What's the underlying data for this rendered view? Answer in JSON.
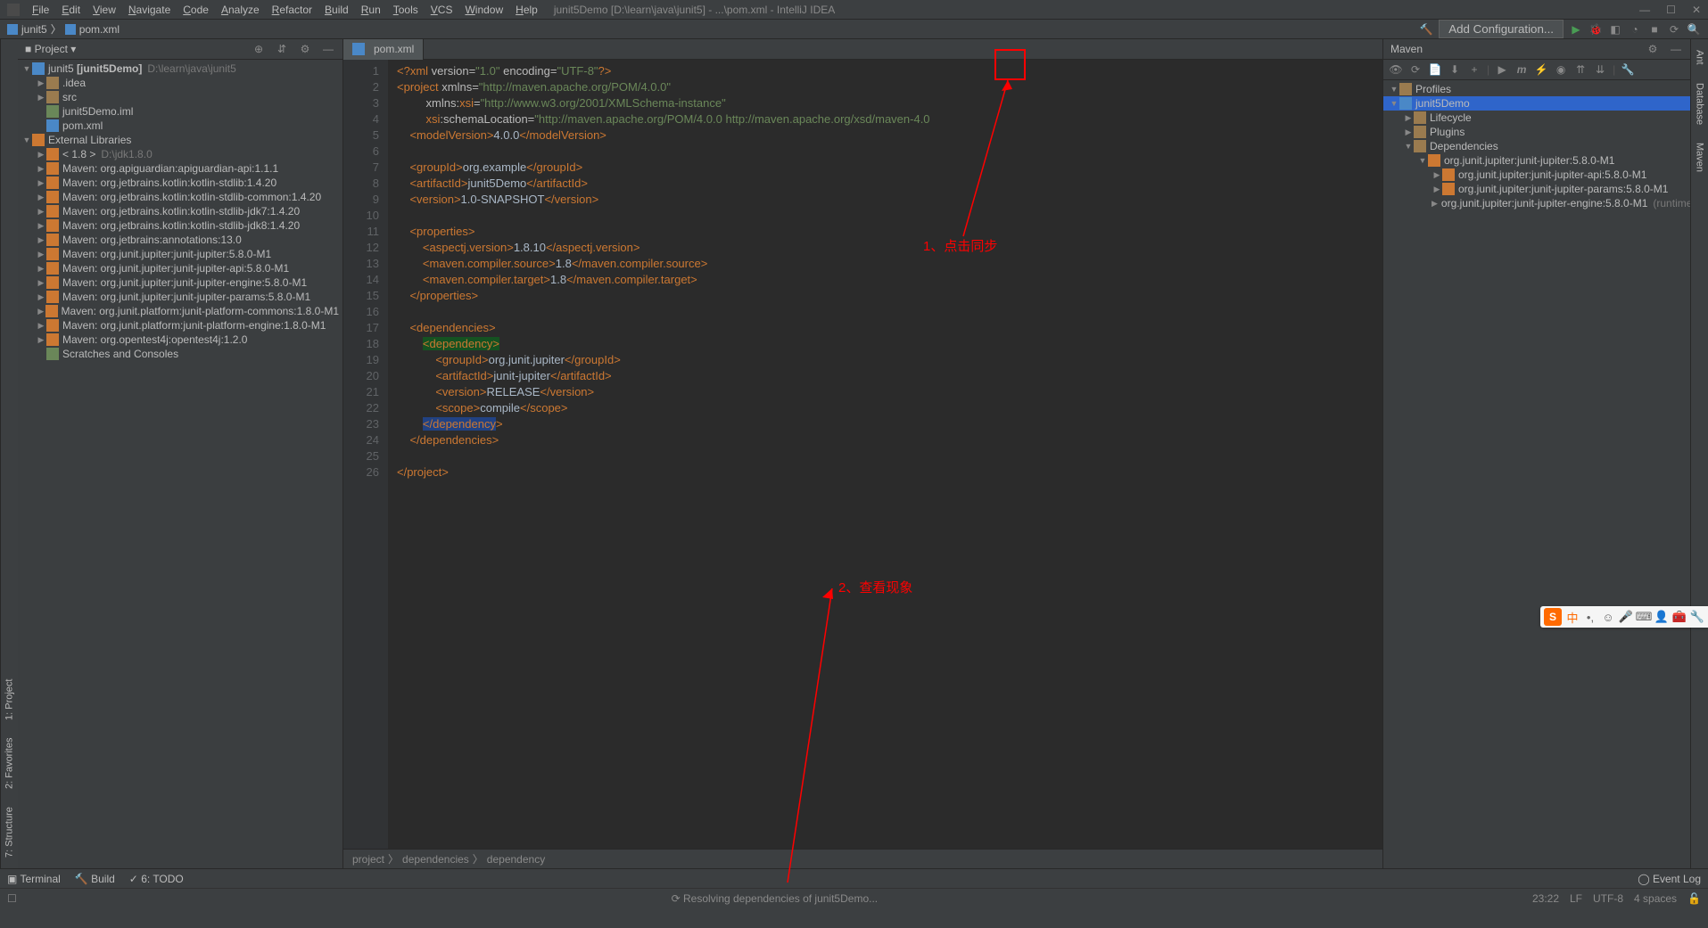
{
  "title_bar": {
    "menus": [
      "File",
      "Edit",
      "View",
      "Navigate",
      "Code",
      "Analyze",
      "Refactor",
      "Build",
      "Run",
      "Tools",
      "VCS",
      "Window",
      "Help"
    ],
    "title": "junit5Demo [D:\\learn\\java\\junit5] - ...\\pom.xml - IntelliJ IDEA"
  },
  "nav": {
    "crumbs": [
      "junit5",
      "pom.xml"
    ],
    "add_config": "Add Configuration..."
  },
  "project": {
    "header": "Project",
    "root": "junit5",
    "root_bold": "[junit5Demo]",
    "root_path": "D:\\learn\\java\\junit5",
    "items": [
      {
        "indent": 1,
        "arrow": "▶",
        "icon": "folder",
        "label": ".idea"
      },
      {
        "indent": 1,
        "arrow": "▶",
        "icon": "folder",
        "label": "src"
      },
      {
        "indent": 1,
        "arrow": "",
        "icon": "file",
        "label": "junit5Demo.iml"
      },
      {
        "indent": 1,
        "arrow": "",
        "icon": "m",
        "label": "pom.xml"
      }
    ],
    "ext_lib": "External Libraries",
    "libs": [
      "< 1.8 >  D:\\jdk1.8.0",
      "Maven: org.apiguardian:apiguardian-api:1.1.1",
      "Maven: org.jetbrains.kotlin:kotlin-stdlib:1.4.20",
      "Maven: org.jetbrains.kotlin:kotlin-stdlib-common:1.4.20",
      "Maven: org.jetbrains.kotlin:kotlin-stdlib-jdk7:1.4.20",
      "Maven: org.jetbrains.kotlin:kotlin-stdlib-jdk8:1.4.20",
      "Maven: org.jetbrains:annotations:13.0",
      "Maven: org.junit.jupiter:junit-jupiter:5.8.0-M1",
      "Maven: org.junit.jupiter:junit-jupiter-api:5.8.0-M1",
      "Maven: org.junit.jupiter:junit-jupiter-engine:5.8.0-M1",
      "Maven: org.junit.jupiter:junit-jupiter-params:5.8.0-M1",
      "Maven: org.junit.platform:junit-platform-commons:1.8.0-M1",
      "Maven: org.junit.platform:junit-platform-engine:1.8.0-M1",
      "Maven: org.opentest4j:opentest4j:1.2.0"
    ],
    "scratches": "Scratches and Consoles"
  },
  "editor": {
    "tab": "pom.xml",
    "lines": 26,
    "code": [
      {
        "n": 1,
        "html": "<span class='c-tag'>&lt;?xml</span> <span class='c-attr'>version=</span><span class='c-str'>\"1.0\"</span> <span class='c-attr'>encoding=</span><span class='c-str'>\"UTF-8\"</span><span class='c-tag'>?&gt;</span>"
      },
      {
        "n": 2,
        "html": "<span class='c-tag'>&lt;project</span> <span class='c-attr'>xmlns=</span><span class='c-str'>\"http://maven.apache.org/POM/4.0.0\"</span>"
      },
      {
        "n": 3,
        "html": "         <span class='c-attr'>xmlns:</span><span class='c-tag'>xsi</span><span class='c-attr'>=</span><span class='c-str'>\"http://www.w3.org/2001/XMLSchema-instance\"</span>"
      },
      {
        "n": 4,
        "html": "         <span class='c-tag'>xsi</span><span class='c-attr'>:schemaLocation=</span><span class='c-str'>\"http://maven.apache.org/POM/4.0.0 http://maven.apache.org/xsd/maven-4.0</span>"
      },
      {
        "n": 5,
        "html": "    <span class='c-tag'>&lt;modelVersion&gt;</span>4.0.0<span class='c-tag'>&lt;/modelVersion&gt;</span>"
      },
      {
        "n": 6,
        "html": ""
      },
      {
        "n": 7,
        "html": "    <span class='c-tag'>&lt;groupId&gt;</span>org.example<span class='c-tag'>&lt;/groupId&gt;</span>"
      },
      {
        "n": 8,
        "html": "    <span class='c-tag'>&lt;artifactId&gt;</span>junit5Demo<span class='c-tag'>&lt;/artifactId&gt;</span>"
      },
      {
        "n": 9,
        "html": "    <span class='c-tag'>&lt;version&gt;</span>1.0-SNAPSHOT<span class='c-tag'>&lt;/version&gt;</span>"
      },
      {
        "n": 10,
        "html": ""
      },
      {
        "n": 11,
        "html": "    <span class='c-tag'>&lt;properties&gt;</span>"
      },
      {
        "n": 12,
        "html": "        <span class='c-tag'>&lt;aspectj.version&gt;</span>1.8.10<span class='c-tag'>&lt;/aspectj.version&gt;</span>"
      },
      {
        "n": 13,
        "html": "        <span class='c-tag'>&lt;maven.compiler.source&gt;</span>1.8<span class='c-tag'>&lt;/maven.compiler.source&gt;</span>"
      },
      {
        "n": 14,
        "html": "        <span class='c-tag'>&lt;maven.compiler.target&gt;</span>1.8<span class='c-tag'>&lt;/maven.compiler.target&gt;</span>"
      },
      {
        "n": 15,
        "html": "    <span class='c-tag'>&lt;/properties&gt;</span>"
      },
      {
        "n": 16,
        "html": ""
      },
      {
        "n": 17,
        "html": "    <span class='c-tag'>&lt;dependencies&gt;</span>"
      },
      {
        "n": 18,
        "html": "        <span class='c-hl2'><span class='c-tag'>&lt;dependency&gt;</span></span>"
      },
      {
        "n": 19,
        "html": "            <span class='c-tag'>&lt;groupId&gt;</span>org.junit.jupiter<span class='c-tag'>&lt;/groupId&gt;</span>"
      },
      {
        "n": 20,
        "html": "            <span class='c-tag'>&lt;artifactId&gt;</span>junit-jupiter<span class='c-tag'>&lt;/artifactId&gt;</span>"
      },
      {
        "n": 21,
        "html": "            <span class='c-tag'>&lt;version&gt;</span>RELEASE<span class='c-tag'>&lt;/version&gt;</span>"
      },
      {
        "n": 22,
        "html": "            <span class='c-tag'>&lt;scope&gt;</span>compile<span class='c-tag'>&lt;/scope&gt;</span>"
      },
      {
        "n": 23,
        "html": "        <span class='c-hl'><span class='c-tag'>&lt;/dependency</span></span><span class='c-tag'>&gt;</span>"
      },
      {
        "n": 24,
        "html": "    <span class='c-tag'>&lt;/dependencies&gt;</span>"
      },
      {
        "n": 25,
        "html": ""
      },
      {
        "n": 26,
        "html": "<span class='c-tag'>&lt;/project&gt;</span>"
      }
    ],
    "breadcrumbs": [
      "project",
      "dependencies",
      "dependency"
    ]
  },
  "maven": {
    "title": "Maven",
    "tree": [
      {
        "indent": 0,
        "arrow": "▼",
        "icon": "folder",
        "label": "Profiles"
      },
      {
        "indent": 0,
        "arrow": "▼",
        "icon": "m",
        "label": "junit5Demo",
        "selected": true
      },
      {
        "indent": 1,
        "arrow": "▶",
        "icon": "folder",
        "label": "Lifecycle"
      },
      {
        "indent": 1,
        "arrow": "▶",
        "icon": "folder",
        "label": "Plugins"
      },
      {
        "indent": 1,
        "arrow": "▼",
        "icon": "folder",
        "label": "Dependencies"
      },
      {
        "indent": 2,
        "arrow": "▼",
        "icon": "lib",
        "label": "org.junit.jupiter:junit-jupiter:5.8.0-M1"
      },
      {
        "indent": 3,
        "arrow": "▶",
        "icon": "lib",
        "label": "org.junit.jupiter:junit-jupiter-api:5.8.0-M1"
      },
      {
        "indent": 3,
        "arrow": "▶",
        "icon": "lib",
        "label": "org.junit.jupiter:junit-jupiter-params:5.8.0-M1"
      },
      {
        "indent": 3,
        "arrow": "▶",
        "icon": "lib",
        "label": "org.junit.jupiter:junit-jupiter-engine:5.8.0-M1",
        "note": "(runtime)"
      }
    ]
  },
  "left_tabs": [
    "1: Project",
    "2: Favorites",
    "7: Structure"
  ],
  "right_tabs": [
    "Ant",
    "Database",
    "Maven"
  ],
  "bottom_tabs": [
    "Terminal",
    "Build",
    "6: TODO"
  ],
  "status": {
    "center": "Resolving dependencies of junit5Demo...",
    "right": [
      "23:22",
      "LF",
      "UTF-8",
      "4 spaces"
    ],
    "event_log": "Event Log"
  },
  "annotations": {
    "step1": "1、点击同步",
    "step2": "2、查看现象"
  }
}
